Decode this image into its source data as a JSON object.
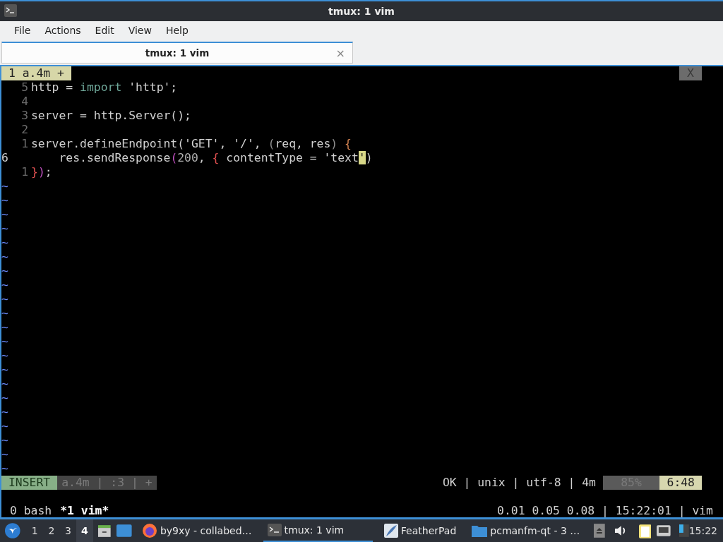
{
  "window": {
    "title": "tmux: 1 vim"
  },
  "menu": [
    "File",
    "Actions",
    "Edit",
    "View",
    "Help"
  ],
  "tabs": [
    {
      "label": "tmux: 1 vim",
      "selected": true,
      "close": "×"
    }
  ],
  "terminal": {
    "tmux_tab": "1 a.4m +",
    "close_tab": "X",
    "code_lines": [
      {
        "number": "5",
        "current": false,
        "tokens": [
          {
            "text": "http = ",
            "color": "#d0d0d0"
          },
          {
            "text": "import",
            "color": "#6fa89a"
          },
          {
            "text": " 'http';",
            "color": "#d0d0d0"
          }
        ]
      },
      {
        "number": "4",
        "current": false
      },
      {
        "number": "3",
        "current": false,
        "tokens": [
          {
            "text": "server = http.Server();",
            "color": "#d0d0d0"
          }
        ]
      },
      {
        "number": "2",
        "current": false
      },
      {
        "number": "1",
        "current": false,
        "tokens": [
          {
            "text": "server.defineEndpoint('GET', '/', ",
            "color": "#d0d0d0"
          },
          {
            "text": "(",
            "color": "#909090"
          },
          {
            "text": "req, res",
            "color": "#d0d0d0"
          },
          {
            "text": ")",
            "color": "#909090"
          },
          {
            "text": " {",
            "color": "#d08050"
          }
        ]
      },
      {
        "number": "6",
        "current": true,
        "tokens": [
          {
            "text": "    res.sendResponse",
            "color": "#d0d0d0"
          },
          {
            "text": "(",
            "color": "#c050c0"
          },
          {
            "text": "200",
            "color": "#b0b0b0"
          },
          {
            "text": ", ",
            "color": "#d0d0d0"
          },
          {
            "text": "{",
            "color": "#e05050"
          },
          {
            "text": " contentType = 'text",
            "color": "#d0d0d0"
          },
          {
            "text": "'",
            "color": "#d7d787",
            "cursor": true
          },
          {
            "text": ")",
            "color": "#d0d0d0"
          }
        ]
      },
      {
        "number": "1",
        "current": false,
        "tokens": [
          {
            "text": "}",
            "color": "#e05050"
          },
          {
            "text": ")",
            "color": "#c050c0"
          },
          {
            "text": ";",
            "color": "#d0d0d0"
          }
        ]
      }
    ],
    "empty_lines": [
      "~",
      "~",
      "~",
      "~",
      "~",
      "~",
      "~",
      "~",
      "~",
      "~",
      "~",
      "~",
      "~",
      "~",
      "~",
      "~",
      "~",
      "~",
      "~",
      "~",
      "~"
    ],
    "statusline": {
      "mode": "INSERT",
      "file_info": "a.4m | :3 | +",
      "right_info": "OK | unix | utf-8 | 4m",
      "percent": "85%",
      "position": "6:48"
    },
    "tmux_status": {
      "windows": [
        {
          "label": "0 bash",
          "selected": false
        },
        {
          "label": "*1 vim*",
          "selected": true
        }
      ],
      "right": "0.01 0.05 0.08 | 15:22:01 | vim"
    }
  },
  "taskbar": {
    "desktops": [
      {
        "label": "1",
        "selected": false
      },
      {
        "label": "2",
        "selected": false
      },
      {
        "label": "3",
        "selected": false
      },
      {
        "label": "4",
        "selected": true
      }
    ],
    "tasks": [
      {
        "kind": "browser",
        "label": "by9xy - collabed…",
        "selected": false
      },
      {
        "kind": "terminal",
        "label": "tmux: 1 vim",
        "selected": true
      },
      {
        "kind": "editor",
        "label": "FeatherPad",
        "selected": false
      },
      {
        "kind": "folder",
        "label": "pcmanfm-qt - 3 …",
        "selected": false
      }
    ],
    "clock": "15:22"
  }
}
